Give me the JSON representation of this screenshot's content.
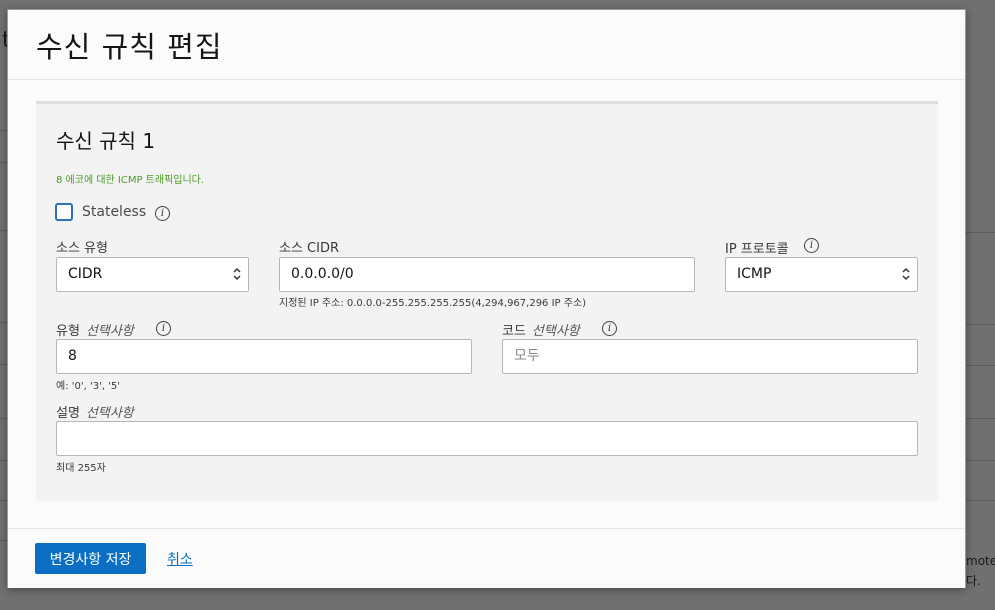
{
  "background": {
    "frag_left_top": "t",
    "frag_right_1": "mote",
    "frag_right_2": "다."
  },
  "modal": {
    "title": "수신 규칙 편집"
  },
  "rule": {
    "title": "수신 규칙 1",
    "hint": "8 에코에 대한 ICMP 트래픽입니다.",
    "stateless": {
      "label": "Stateless",
      "checked": false
    },
    "source_type": {
      "label": "소스 유형",
      "value": "CIDR"
    },
    "source_cidr": {
      "label": "소스 CIDR",
      "value": "0.0.0.0/0",
      "help": "지정된 IP 주소: 0.0.0.0-255.255.255.255(4,294,967,296 IP 주소)"
    },
    "ip_protocol": {
      "label": "IP 프로토콜",
      "value": "ICMP"
    },
    "type": {
      "label": "유형",
      "optional": "선택사항",
      "value": "8",
      "help": "예: '0', '3', '5'"
    },
    "code": {
      "label": "코드",
      "optional": "선택사항",
      "placeholder": "모두"
    },
    "description": {
      "label": "설명",
      "optional": "선택사항",
      "value": "",
      "help": "최대 255자"
    }
  },
  "info_icon_glyph": "i",
  "footer": {
    "save_label": "변경사항 저장",
    "cancel_label": "취소"
  },
  "colors": {
    "primary": "#0a6fc2",
    "hint_green": "#4c9a2a",
    "checkbox_border": "#2f6fbf"
  }
}
